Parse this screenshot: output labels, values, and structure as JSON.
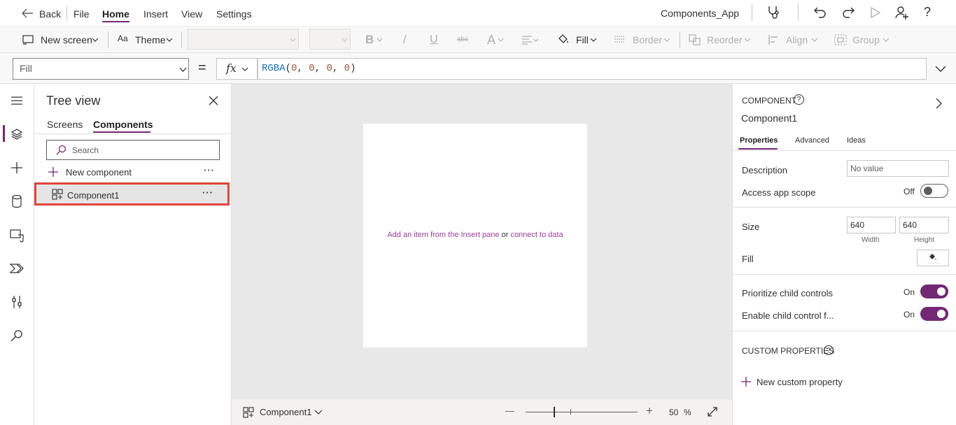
{
  "menubar": {
    "back_label": "Back",
    "items": [
      "File",
      "Home",
      "Insert",
      "View",
      "Settings"
    ],
    "active_item": "Home",
    "app_name": "Components_App"
  },
  "toolbar": {
    "new_screen_label": "New screen",
    "theme_label": "Theme",
    "fill_label": "Fill",
    "border_label": "Border",
    "reorder_label": "Reorder",
    "align_label": "Align",
    "group_label": "Group",
    "bold_glyph": "B",
    "italic_glyph": "/",
    "underline_glyph": "U",
    "strike_glyph": "abc",
    "fontcolor_glyph": "A"
  },
  "formula": {
    "property": "Fill",
    "equals": "=",
    "fx": "fx",
    "fn_name": "RGBA",
    "args": [
      "0",
      "0",
      "0",
      "0"
    ]
  },
  "treeview": {
    "title": "Tree view",
    "tabs": [
      "Screens",
      "Components"
    ],
    "active_tab": "Components",
    "search_placeholder": "Search",
    "new_component_label": "New component",
    "items": [
      {
        "label": "Component1",
        "selected": true
      }
    ],
    "ellipsis": "···"
  },
  "canvas": {
    "hint_link1": "Add an item from the Insert pane",
    "hint_or": "or",
    "hint_link2": "connect to data"
  },
  "statusbar": {
    "component_label": "Component1",
    "zoom_value": "50",
    "zoom_unit": "%",
    "zoom_minus": "—",
    "zoom_plus": "+"
  },
  "rightpane": {
    "section_label": "COMPONENT",
    "component_name": "Component1",
    "tabs": [
      "Properties",
      "Advanced",
      "Ideas"
    ],
    "active_tab": "Properties",
    "description_label": "Description",
    "description_value": "No value",
    "access_scope_label": "Access app scope",
    "access_scope_state": "Off",
    "size_label": "Size",
    "width_value": "640",
    "height_value": "640",
    "width_caption": "Width",
    "height_caption": "Height",
    "fill_label": "Fill",
    "prioritize_label": "Prioritize child controls",
    "prioritize_state": "On",
    "enable_child_label": "Enable child control f...",
    "enable_child_state": "On",
    "custom_props_label": "CUSTOM PROPERTIES",
    "new_custom_property_label": "New custom property"
  },
  "colors": {
    "accent": "#742774",
    "selection_outline": "#e0443a",
    "link": "#9c3d9c"
  }
}
